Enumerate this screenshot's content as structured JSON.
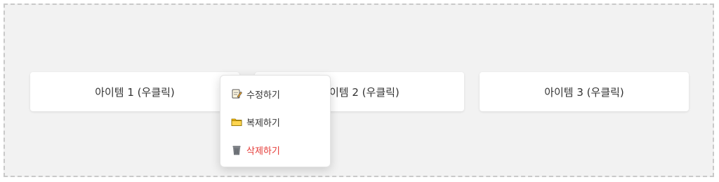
{
  "items": [
    {
      "label": "아이템 1 (우클릭)"
    },
    {
      "label": "아이템 2 (우클릭)"
    },
    {
      "label": "아이템 3 (우클릭)"
    }
  ],
  "context_menu": {
    "items": [
      {
        "label": "수정하기",
        "icon": "memo-edit-icon"
      },
      {
        "label": "복제하기",
        "icon": "folder-icon"
      },
      {
        "label": "삭제하기",
        "icon": "trash-icon",
        "color": "#e53935"
      }
    ]
  }
}
